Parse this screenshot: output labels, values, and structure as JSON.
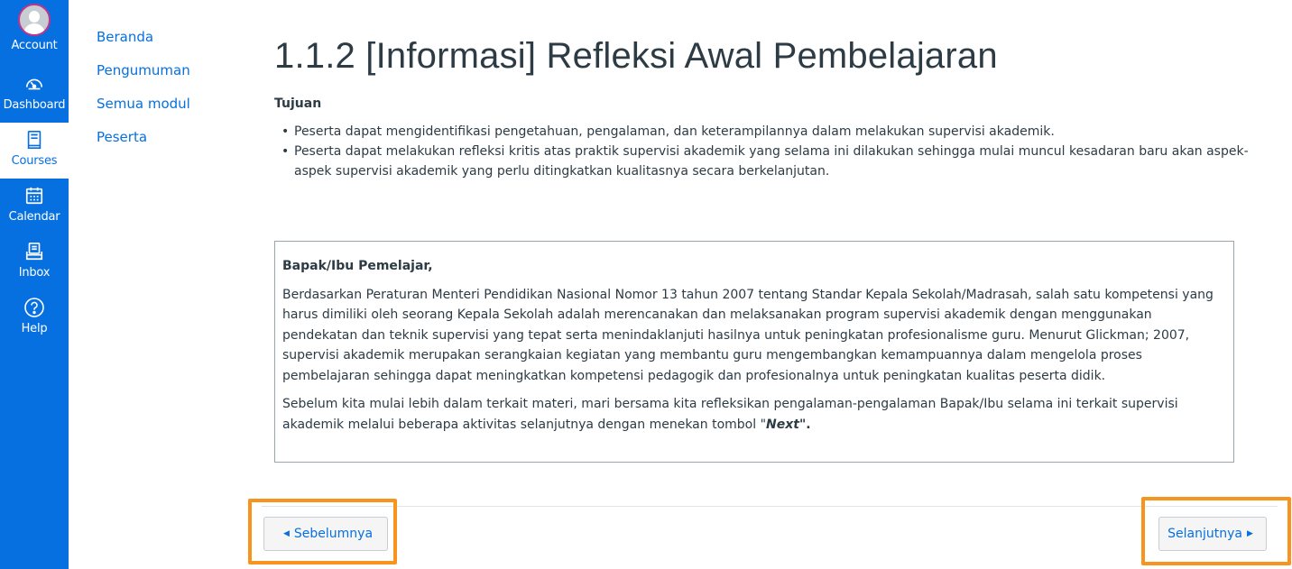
{
  "global_nav": {
    "items": [
      {
        "label": "Account",
        "icon": "account-avatar"
      },
      {
        "label": "Dashboard",
        "icon": "speedometer-icon"
      },
      {
        "label": "Courses",
        "icon": "book-icon"
      },
      {
        "label": "Calendar",
        "icon": "calendar-icon"
      },
      {
        "label": "Inbox",
        "icon": "inbox-icon"
      },
      {
        "label": "Help",
        "icon": "help-icon"
      }
    ],
    "active": "Courses",
    "color": "#0770e0"
  },
  "course_nav": {
    "items": [
      "Beranda",
      "Pengumuman",
      "Semua modul",
      "Peserta"
    ]
  },
  "main": {
    "title": "1.1.2 [Informasi] Refleksi Awal Pembelajaran",
    "section_heading": "Tujuan",
    "bullets": [
      "Peserta dapat mengidentifikasi pengetahuan, pengalaman, dan keterampilannya dalam melakukan supervisi akademik.",
      "Peserta dapat melakukan refleksi kritis atas praktik supervisi akademik yang selama ini dilakukan sehingga mulai muncul kesadaran baru akan aspek-aspek supervisi akademik yang perlu ditingkatkan kualitasnya secara berkelanjutan."
    ],
    "notice": {
      "greeting": "Bapak/Ibu Pemelajar,",
      "paragraph1": "Berdasarkan Peraturan Menteri Pendidikan Nasional Nomor 13 tahun 2007 tentang Standar Kepala Sekolah/Madrasah, salah satu kompetensi yang harus dimiliki oleh seorang Kepala Sekolah adalah merencanakan dan melaksanakan program supervisi akademik dengan menggunakan pendekatan dan teknik supervisi yang tepat serta menindaklanjuti hasilnya untuk peningkatan profesionalisme guru. Menurut Glickman; 2007, supervisi akademik merupakan serangkaian kegiatan yang membantu guru mengembangkan kemampuannya dalam mengelola proses pembelajaran sehingga dapat meningkatkan kompetensi pedagogik dan profesionalnya untuk peningkatan kualitas peserta didik.",
      "paragraph2_before": "Sebelum kita mulai lebih dalam terkait materi, mari bersama kita refleksikan pengalaman-pengalaman Bapak/Ibu selama ini terkait supervisi akademik melalui beberapa aktivitas selanjutnya dengan menekan tombol \"",
      "paragraph2_emph": "Next",
      "paragraph2_after": "\"."
    }
  },
  "footer": {
    "prev_label": "Sebelumnya",
    "next_label": "Selanjutnya",
    "highlight_color": "#f7941d"
  }
}
